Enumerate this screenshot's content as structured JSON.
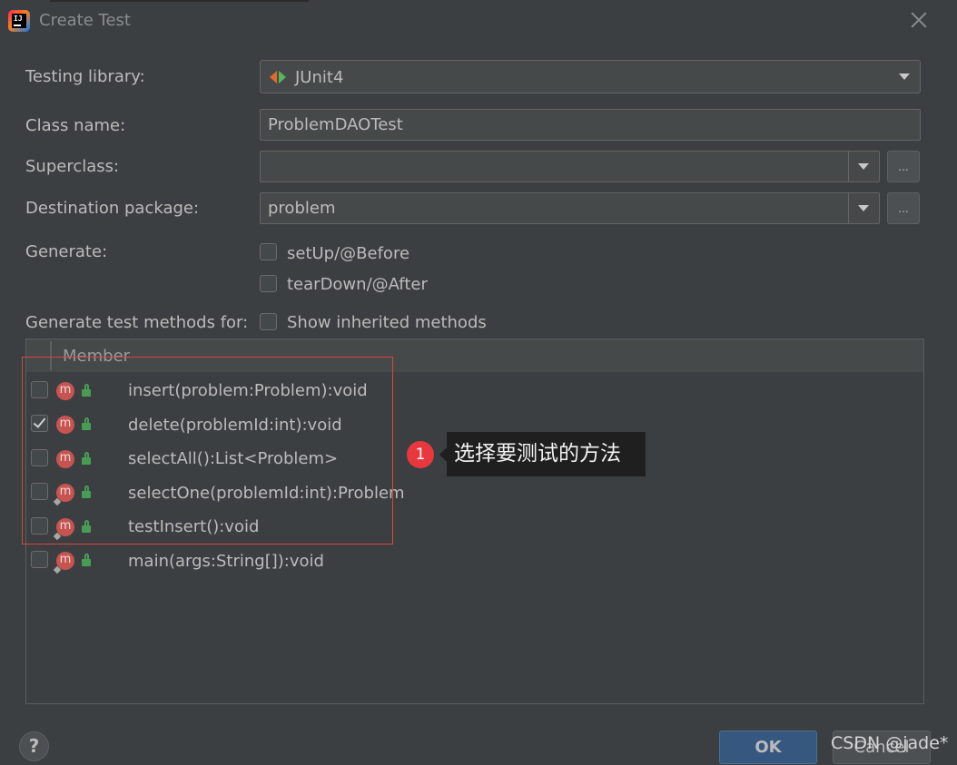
{
  "window": {
    "title": "Create Test"
  },
  "form": {
    "testing_library": {
      "label": "Testing library:",
      "value": "JUnit4",
      "icon": "junit-icon"
    },
    "class_name": {
      "label": "Class name:",
      "value": "ProblemDAOTest"
    },
    "superclass": {
      "label": "Superclass:",
      "value": "",
      "browse": "..."
    },
    "destination_package": {
      "label": "Destination package:",
      "value": "problem",
      "browse": "..."
    },
    "generate": {
      "label": "Generate:",
      "options": [
        {
          "label": "setUp/@Before",
          "checked": false
        },
        {
          "label": "tearDown/@After",
          "checked": false
        }
      ]
    },
    "generate_for": {
      "label": "Generate test methods for:",
      "show_inherited": {
        "label": "Show inherited methods",
        "checked": false
      }
    }
  },
  "members_table": {
    "header": "Member",
    "rows": [
      {
        "checked": false,
        "text": "insert(problem:Problem):void"
      },
      {
        "checked": true,
        "text": "delete(problemId:int):void"
      },
      {
        "checked": false,
        "text": "selectAll():List<Problem>"
      },
      {
        "checked": false,
        "text": "selectOne(problemId:int):Problem"
      },
      {
        "checked": false,
        "text": "testInsert():void"
      },
      {
        "checked": false,
        "text": "main(args:String[]):void"
      }
    ]
  },
  "annotation": {
    "badge": "1",
    "text": "选择要测试的方法",
    "highlight_color": "#d9453f"
  },
  "footer": {
    "help": "?",
    "ok": "OK",
    "cancel": "Cancel",
    "watermark": "CSDN @jade*"
  },
  "colors": {
    "background": "#3c3f41",
    "field": "#45494a",
    "ok_button": "#365880",
    "method_icon": "#c75450",
    "lock": "#499c54"
  }
}
